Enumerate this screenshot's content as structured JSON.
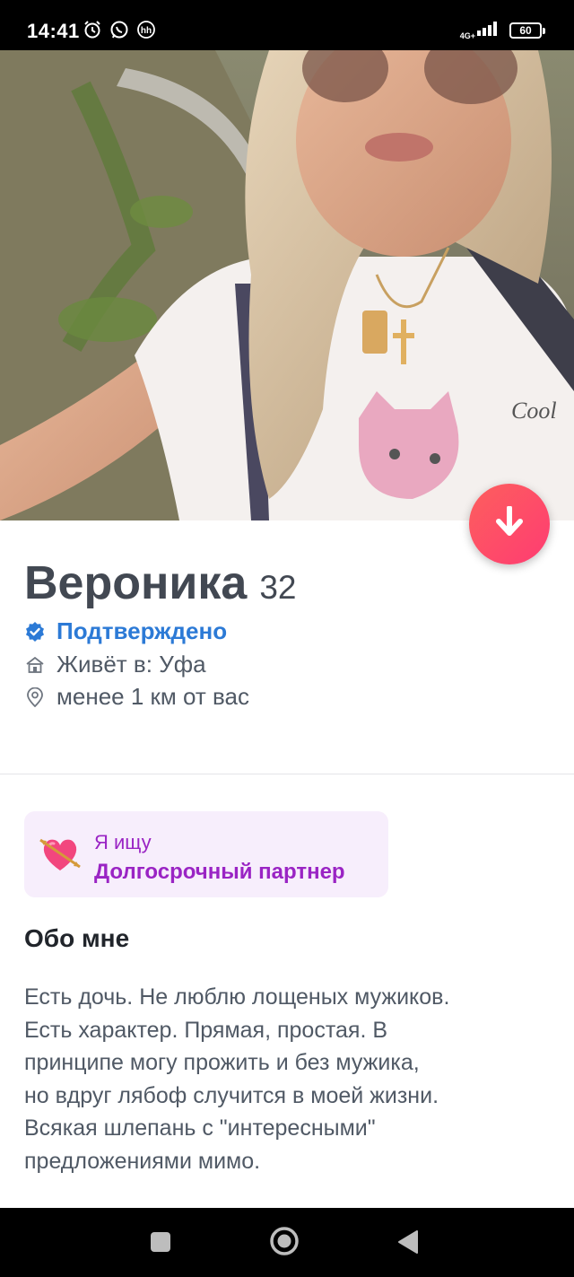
{
  "status_bar": {
    "time": "14:41",
    "network": "4G+",
    "battery": "60"
  },
  "profile": {
    "name": "Вероника",
    "age": "32",
    "verified_label": "Подтверждено",
    "lives_in": "Живёт в: Уфа",
    "distance": "менее 1 км от вас"
  },
  "looking_for": {
    "label": "Я ищу",
    "value": "Долгосрочный партнер"
  },
  "about": {
    "title": "Обо мне",
    "lines": [
      "Есть дочь. Не люблю лощеных мужиков.",
      "Есть характер. Прямая, простая. В",
      "принципе могу прожить и без мужика,",
      "но вдруг лябоф случится в моей жизни.",
      "Всякая шлепань с \"интересными\"",
      "предложениями мимо."
    ]
  },
  "colors": {
    "accent_gradient_start": "#fd5f5d",
    "accent_gradient_end": "#fe3c72",
    "verified_blue": "#2c7ad6",
    "looking_purple": "#9a24c4"
  },
  "icons": {
    "alarm": "alarm-icon",
    "whatsapp": "whatsapp-icon",
    "hh": "hh-icon",
    "signal": "signal-icon",
    "verified": "verified-check-icon",
    "home": "home-icon",
    "location": "location-pin-icon",
    "down": "arrow-down-icon",
    "heart": "heart-arrow-icon"
  }
}
